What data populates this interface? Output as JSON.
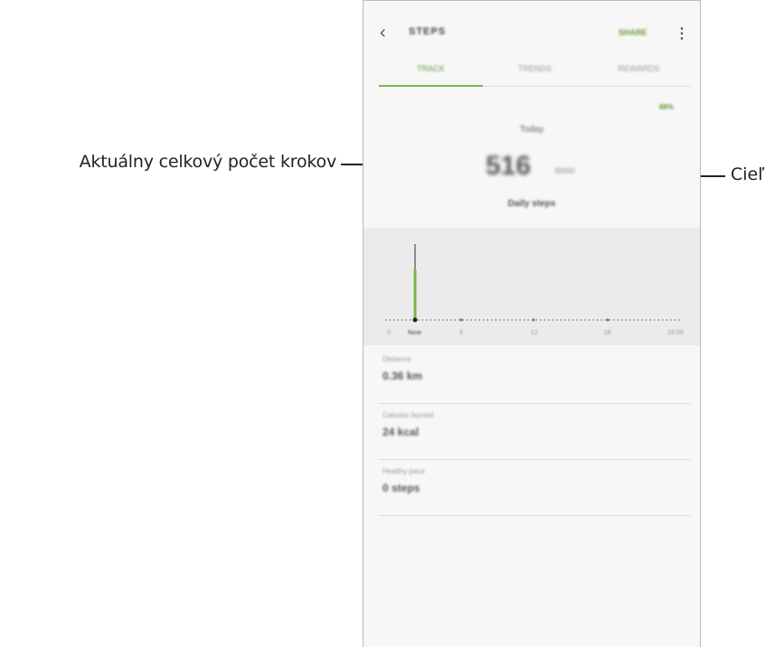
{
  "callouts": {
    "left": "Aktuálny celkový počet krokov",
    "right": "Cieľ"
  },
  "header": {
    "title": "STEPS",
    "share_label": "SHARE"
  },
  "tabs": [
    {
      "label": "TRACK",
      "active": true
    },
    {
      "label": "TRENDS",
      "active": false
    },
    {
      "label": "REWARDS",
      "active": false
    }
  ],
  "summary": {
    "badge": "88%",
    "day_label": "Today",
    "steps_count": "516",
    "goal": "/6000",
    "daily_steps_label": "Daily steps"
  },
  "chart_data": {
    "type": "bar",
    "x_tick_labels": [
      "0",
      "Now",
      "6",
      "12",
      "18",
      "23:59"
    ]
  },
  "stats": [
    {
      "label": "Distance",
      "value": "0.36 km"
    },
    {
      "label": "Calories burned",
      "value": "24 kcal"
    },
    {
      "label": "Healthy pace",
      "value": "0 steps"
    }
  ],
  "colors": {
    "accent": "#7ab648",
    "chart_bg": "#ebebeb"
  }
}
